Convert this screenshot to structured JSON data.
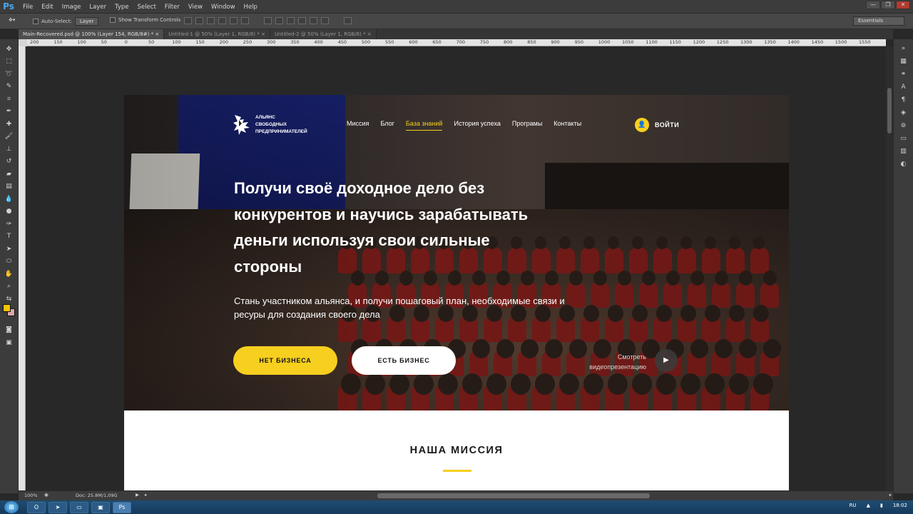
{
  "app": {
    "logo": "Ps",
    "menu": [
      "File",
      "Edit",
      "Image",
      "Layer",
      "Type",
      "Select",
      "Filter",
      "View",
      "Window",
      "Help"
    ],
    "window_controls": [
      "—",
      "❐",
      "✕"
    ]
  },
  "options": {
    "auto_select_label": "Auto-Select:",
    "auto_select_value": "Layer",
    "transform_label": "Show Transform Controls",
    "workspace": "Essentials"
  },
  "tabs": [
    {
      "label": "Main-Recovered.psd @ 100% (Layer 154, RGB/8#) *",
      "active": true
    },
    {
      "label": "Untitled-1 @ 50% (Layer 1, RGB/8) *",
      "active": false
    },
    {
      "label": "Untitled-2 @ 50% (Layer 1, RGB/8) *",
      "active": false
    }
  ],
  "ruler_ticks": [
    "200",
    "150",
    "100",
    "50",
    "0",
    "50",
    "100",
    "150",
    "200",
    "250",
    "300",
    "350",
    "400",
    "450",
    "500",
    "550",
    "600",
    "650",
    "700",
    "750",
    "800",
    "850",
    "900",
    "950",
    "1000",
    "1050",
    "1100",
    "1150",
    "1200",
    "1250",
    "1300",
    "1350",
    "1400",
    "1450",
    "1500",
    "1550"
  ],
  "status": {
    "zoom": "100%",
    "doc": "Doc: 25.8M/1,09G"
  },
  "colors": {
    "foreground": "#f3c300",
    "background": "#d9a8a8",
    "accent": "#f7cf1f"
  },
  "site": {
    "logo_lines": [
      "АЛЬЯНС",
      "СВОБОДНЫХ",
      "ПРЕДПРИНИМАТЕЛЕЙ"
    ],
    "nav": [
      {
        "label": "Миссия",
        "active": false
      },
      {
        "label": "Блог",
        "active": false
      },
      {
        "label": "База знаний",
        "active": true
      },
      {
        "label": "История успеха",
        "active": false
      },
      {
        "label": "Програмы",
        "active": false
      },
      {
        "label": "Контакты",
        "active": false
      }
    ],
    "login": "ВОЙТИ",
    "headline": "Получи своё доходное дело без конкурентов и научись зарабатывать деньги используя свои сильные стороны",
    "subtitle": "Стань участником альянса, и получи пошаговый план, необходимые связи и ресуры для создания своего дела",
    "btn_no_business": "НЕТ БИЗНЕСА",
    "btn_business": "ЕСТЬ БИЗНЕС",
    "video_label": "Смотреть видеопрезентацию",
    "mission_title": "НАША МИССИЯ"
  },
  "taskbar": {
    "lang": "RU",
    "time": "18:02",
    "apps": [
      "opera-icon",
      "telegram-icon",
      "explorer-icon",
      "ps-doc-icon",
      "photoshop-icon"
    ]
  }
}
